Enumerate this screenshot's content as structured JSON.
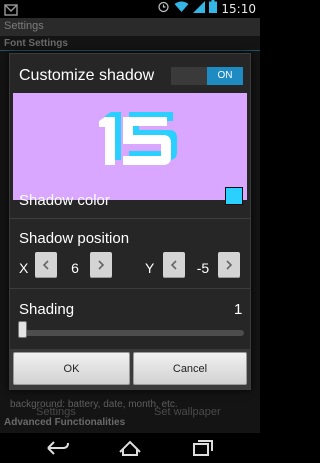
{
  "status_bar": {
    "time": "15:10"
  },
  "background": {
    "title": "Settings",
    "section_font": "Font Settings",
    "bottom_text": "background: battery, date, month, etc.",
    "settings_label": "Settings",
    "wallpaper_label": "Set wallpaper",
    "section_advanced": "Advanced Functionalities"
  },
  "dialog": {
    "title": "Customize shadow",
    "toggle_state": "ON",
    "preview_text": "15",
    "preview_bg": "#d9a7ff",
    "shadow_color_label": "Shadow color",
    "shadow_color_value": "#2ad0ff",
    "shadow_position_label": "Shadow position",
    "x_label": "X",
    "x_value": "6",
    "y_label": "Y",
    "y_value": "-5",
    "shading_label": "Shading",
    "shading_value": "1",
    "ok_label": "OK",
    "cancel_label": "Cancel"
  },
  "icons": [
    "notification-icon",
    "alarm-icon",
    "wifi-icon",
    "signal-icon",
    "battery-icon",
    "back-icon",
    "home-icon",
    "recents-icon",
    "chevron-left-icon",
    "chevron-right-icon"
  ]
}
